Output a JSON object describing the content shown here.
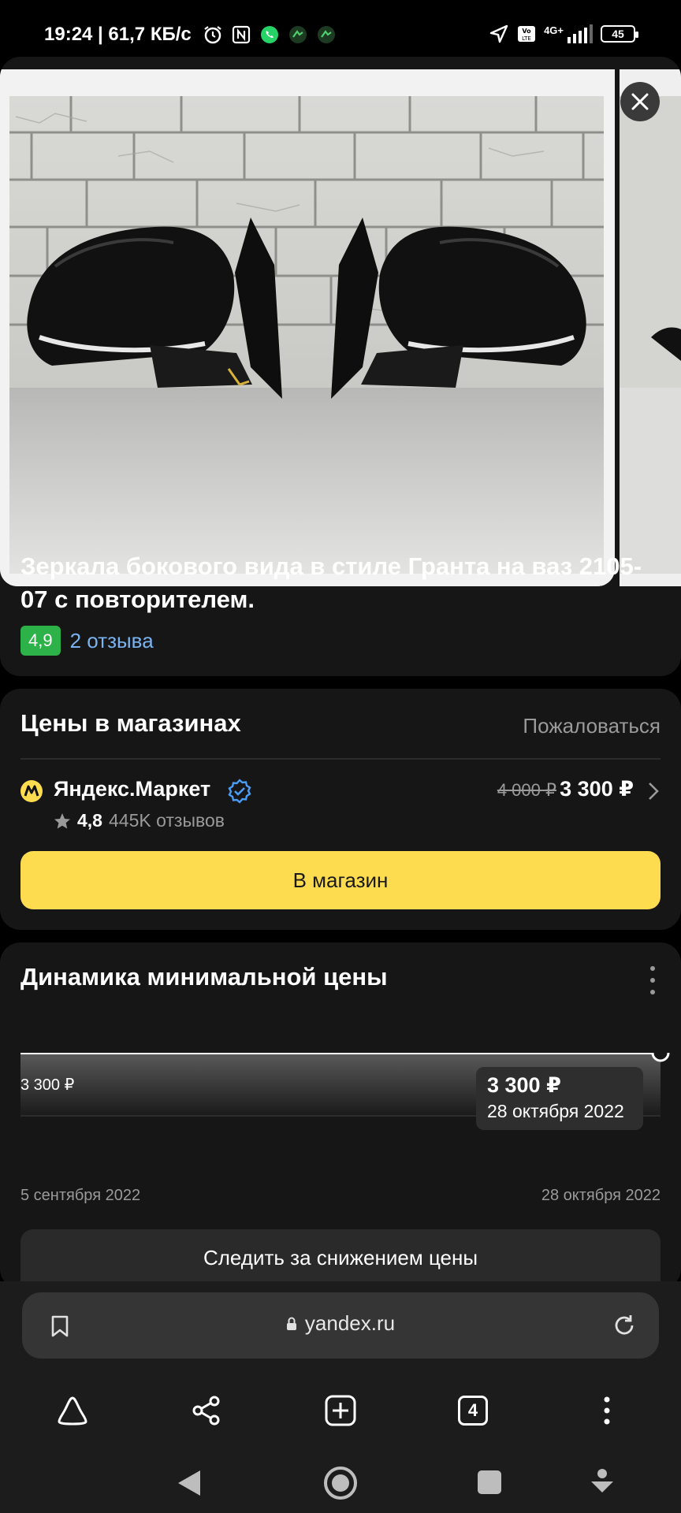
{
  "status_bar": {
    "time_speed": "19:24 | 61,7 КБ/с",
    "network": "4G+",
    "battery": "45"
  },
  "product": {
    "title": "Зеркала бокового вида в стиле Гранта на ваз 2105-07 с повторителем.",
    "rating": "4,9",
    "reviews": "2 отзыва"
  },
  "prices": {
    "section_title": "Цены в магазинах",
    "complain": "Пожаловаться",
    "shop_name": "Яндекс.Маркет",
    "shop_rating": "4,8",
    "shop_reviews": "445K отзывов",
    "old_price": "4 000 ₽",
    "new_price": "3 300 ₽",
    "button": "В магазин"
  },
  "price_dynamics": {
    "title": "Динамика минимальной цены",
    "left_price": "3 300 ₽",
    "tooltip_price": "3 300 ₽",
    "tooltip_date": "28 октября 2022",
    "date_start": "5 сентября 2022",
    "date_end": "28 октября 2022",
    "track_button": "Следить за снижением цены"
  },
  "chart_data": {
    "type": "area",
    "x": [
      "5 сентября 2022",
      "28 октября 2022"
    ],
    "series": [
      {
        "values": [
          3300,
          3300
        ]
      }
    ],
    "title": "Динамика минимальной цены"
  },
  "browser": {
    "url": "yandex.ru",
    "tab_count": "4"
  }
}
